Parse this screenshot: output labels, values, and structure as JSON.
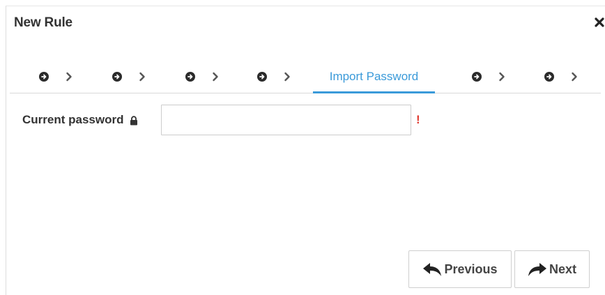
{
  "dialog": {
    "title": "New Rule",
    "close_icon": "close-icon"
  },
  "steps": [
    {
      "icon": "arrow-circle-right-icon",
      "state": "pending"
    },
    {
      "icon": "arrow-circle-right-icon",
      "state": "pending"
    },
    {
      "icon": "arrow-circle-right-icon",
      "state": "pending"
    },
    {
      "icon": "arrow-circle-right-icon",
      "state": "pending"
    },
    {
      "label": "Import Password",
      "state": "active"
    },
    {
      "icon": "arrow-circle-right-icon",
      "state": "pending"
    },
    {
      "icon": "arrow-circle-right-icon",
      "state": "pending"
    }
  ],
  "form": {
    "current_password_label": "Current password",
    "current_password_icon": "lock-icon",
    "current_password_value": "",
    "required_marker": "!"
  },
  "footer": {
    "previous_label": "Previous",
    "previous_icon": "reply-arrow-icon",
    "next_label": "Next",
    "next_icon": "share-arrow-icon"
  },
  "colors": {
    "accent": "#3a9ad9",
    "required": "#e03a2f",
    "text": "#333333",
    "border": "#cccccc"
  }
}
